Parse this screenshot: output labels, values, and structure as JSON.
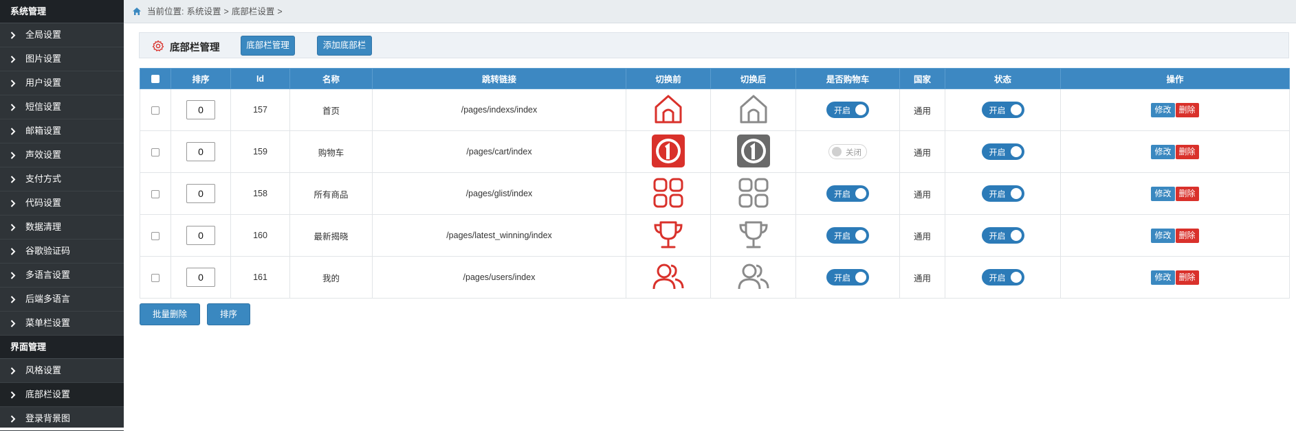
{
  "sidebar": {
    "sections": [
      {
        "title": "系统管理",
        "items": [
          "全局设置",
          "图片设置",
          "用户设置",
          "短信设置",
          "邮箱设置",
          "声效设置",
          "支付方式",
          "代码设置",
          "数据清理",
          "谷歌验证码",
          "多语言设置",
          "后端多语言",
          "菜单栏设置"
        ]
      },
      {
        "title": "界面管理",
        "items": [
          "风格设置",
          "底部栏设置",
          "登录背景图"
        ]
      }
    ],
    "active_item": "底部栏设置"
  },
  "breadcrumb": {
    "prefix": "当前位置:",
    "items": [
      "系统设置",
      ">",
      "底部栏设置",
      ">"
    ]
  },
  "panel": {
    "title": "底部栏管理",
    "tab_button": "底部栏管理",
    "add_button": "添加底部栏"
  },
  "table": {
    "headers": [
      "排序",
      "Id",
      "名称",
      "跳转链接",
      "切换前",
      "切换后",
      "是否购物车",
      "国家",
      "状态",
      "操作"
    ],
    "rows": [
      {
        "sort": "0",
        "id": "157",
        "name": "首页",
        "link": "/pages/indexs/index",
        "icon": "home-icon",
        "cart": "开启",
        "country": "通用",
        "status": "开启"
      },
      {
        "sort": "0",
        "id": "159",
        "name": "购物车",
        "link": "/pages/cart/index",
        "icon": "number-one-icon",
        "cart": "关闭",
        "country": "通用",
        "status": "开启"
      },
      {
        "sort": "0",
        "id": "158",
        "name": "所有商品",
        "link": "/pages/glist/index",
        "icon": "grid-icon",
        "cart": "开启",
        "country": "通用",
        "status": "开启"
      },
      {
        "sort": "0",
        "id": "160",
        "name": "最新揭晓",
        "link": "/pages/latest_winning/index",
        "icon": "trophy-icon",
        "cart": "开启",
        "country": "通用",
        "status": "开启"
      },
      {
        "sort": "0",
        "id": "161",
        "name": "我的",
        "link": "/pages/users/index",
        "icon": "users-icon",
        "cart": "开启",
        "country": "通用",
        "status": "开启"
      }
    ],
    "edit_label": "修改",
    "delete_label": "删除"
  },
  "footer": {
    "batch_delete": "批量删除",
    "sort": "排序"
  },
  "colors": {
    "accent": "#3a88c0",
    "icon_active": "#d9312b",
    "icon_inactive": "#8a8a8a",
    "danger": "#d9312b"
  }
}
